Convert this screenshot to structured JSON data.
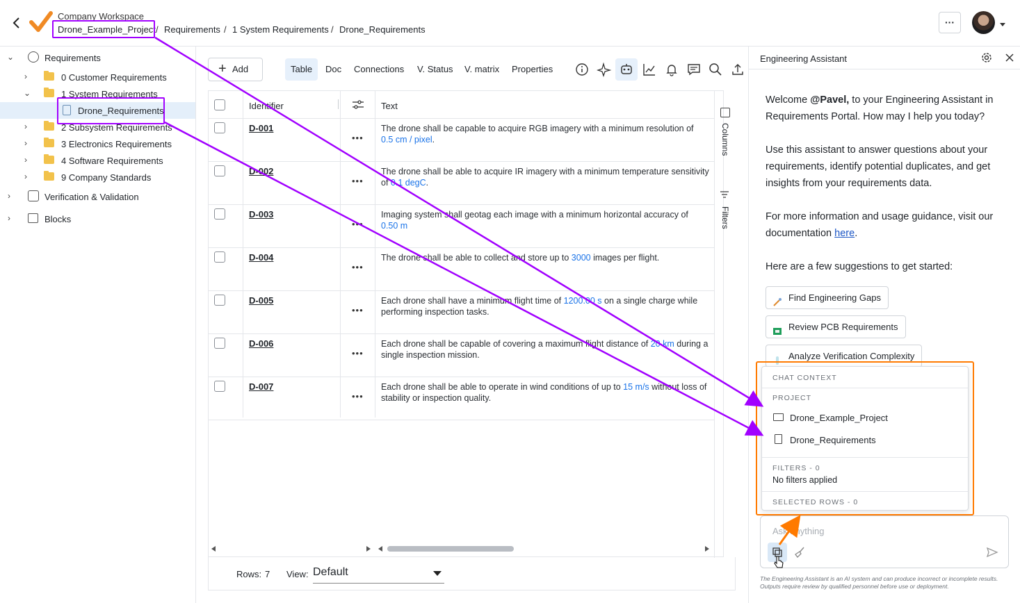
{
  "header": {
    "workspace": "Company Workspace",
    "breadcrumbs": [
      "Drone_Example_Project",
      "Requirements",
      "1 System Requirements",
      "Drone_Requirements"
    ],
    "more_label": "···"
  },
  "sidebar": {
    "items": [
      {
        "label": "Requirements"
      },
      {
        "label": "0 Customer Requirements"
      },
      {
        "label": "1 System Requirements"
      },
      {
        "label": "Drone_Requirements"
      },
      {
        "label": "2 Subsystem Requirements"
      },
      {
        "label": "3 Electronics Requirements"
      },
      {
        "label": "4 Software Requirements"
      },
      {
        "label": "9 Company Standards"
      },
      {
        "label": "Verification & Validation"
      },
      {
        "label": "Blocks"
      }
    ]
  },
  "toolbar": {
    "add_label": "Add",
    "tabs": [
      "Table",
      "Doc",
      "Connections",
      "V. Status",
      "V. matrix",
      "Properties"
    ]
  },
  "table": {
    "headers": {
      "identifier": "Identifier",
      "text": "Text"
    },
    "side_tabs": {
      "columns": "Columns",
      "filters": "Filters"
    },
    "rows": [
      {
        "id": "D-001",
        "pre": "The drone shall be capable to acquire RGB imagery with a minimum resolution of",
        "value": "0.5  cm / pixel",
        "post": "."
      },
      {
        "id": "D-002",
        "pre": "The drone shall be able to acquire IR imagery with a minimum temperature sensitivity of",
        "value": "0.1  degC",
        "post": "."
      },
      {
        "id": "D-003",
        "pre": "Imaging system shall geotag each image with a minimum horizontal accuracy of",
        "value": "0.50  m",
        "post": ""
      },
      {
        "id": "D-004",
        "pre": "The drone shall be able to collect and store up to",
        "value": "3000",
        "post": " images per flight."
      },
      {
        "id": "D-005",
        "pre": "Each drone shall have a minimum flight time of",
        "value": "1200.00  s",
        "post": " on a single charge while performing inspection tasks."
      },
      {
        "id": "D-006",
        "pre": "Each drone shall be capable of covering a maximum flight distance of",
        "value": "20  km",
        "post": " during a single inspection mission."
      },
      {
        "id": "D-007",
        "pre": "Each drone shall be able to operate in wind conditions of up to",
        "value": "15  m/s",
        "post": " without loss of stability or inspection quality."
      }
    ]
  },
  "footer": {
    "rows_label": "Rows:",
    "rows_count": "7",
    "view_label": "View:",
    "view_value": "Default"
  },
  "assistant": {
    "title": "Engineering Assistant",
    "welcome_pre": "Welcome ",
    "user": "@Pavel,",
    "welcome_post": " to your Engineering Assistant in Requirements Portal. How may I help you today?",
    "para2": "Use this assistant to answer questions about your requirements, identify potential duplicates, and get insights from your requirements data.",
    "para3_pre": "For more information and usage guidance, visit our documentation ",
    "para3_link": "here",
    "para3_post": ".",
    "suggest_intro": "Here are a few suggestions to get started:",
    "suggestions": [
      "Find Engineering Gaps",
      "Review PCB Requirements",
      "Analyze Verification Complexity"
    ],
    "input_placeholder": "Ask anything",
    "disclaimer": "The Engineering Assistant is an AI system and can produce incorrect or incomplete results. Outputs require review by qualified personnel before use or deployment."
  },
  "chat_context": {
    "title": "CHAT CONTEXT",
    "project_header": "PROJECT",
    "project_items": [
      "Drone_Example_Project",
      "Drone_Requirements"
    ],
    "filters_header": "FILTERS - 0",
    "filters_text": "No filters applied",
    "selected_header": "SELECTED ROWS - 0"
  },
  "colors": {
    "accent_blue": "#1a73e8",
    "annotation_purple": "#a100ff",
    "annotation_orange": "#ff7a00",
    "logo_orange": "#f08a24"
  }
}
